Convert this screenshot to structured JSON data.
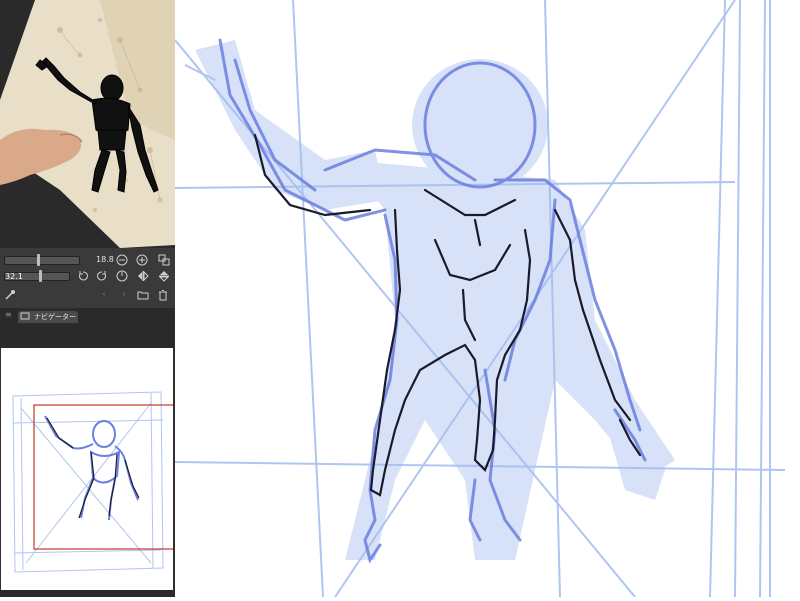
{
  "sub_view": {
    "zoom_value": "18.8",
    "zoom_slider_level": 0.45,
    "rotate_value": "32.1",
    "rotate_slider_level": 0.55
  },
  "navigator": {
    "tab_label": "ナビゲーター"
  },
  "icons": {
    "zoom_out": "minus-circle",
    "zoom_in": "plus-circle",
    "fit": "fit-view",
    "rotate_left": "rotate-left",
    "rotate_right": "rotate-right",
    "reset_rotation": "reset",
    "flip_horizontal": "flip-horizontal",
    "flip_vertical": "flip-vertical",
    "eyedropper": "eyedropper",
    "prev": "chevron-left",
    "next": "chevron-right",
    "open": "folder-open",
    "delete": "trash"
  },
  "colors": {
    "panel_bg": "#2f2f2f",
    "toolbar_bg": "#3a3a3a",
    "stroke_light": "#a7bff0",
    "stroke_mid": "#6a7fe0",
    "stroke_dark": "#1a1a2a",
    "navigator_frame": "#c0392b"
  }
}
